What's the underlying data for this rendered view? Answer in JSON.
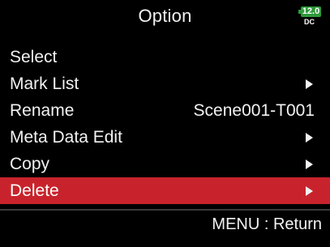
{
  "header": {
    "title": "Option",
    "battery_level": "12.0",
    "power_source": "DC"
  },
  "menu": {
    "items": [
      {
        "label": "Select",
        "value": "",
        "has_arrow": false
      },
      {
        "label": "Mark List",
        "value": "",
        "has_arrow": true
      },
      {
        "label": "Rename",
        "value": "Scene001-T001",
        "has_arrow": false
      },
      {
        "label": "Meta Data Edit",
        "value": "",
        "has_arrow": true
      },
      {
        "label": "Copy",
        "value": "",
        "has_arrow": true
      },
      {
        "label": "Delete",
        "value": "",
        "has_arrow": true,
        "selected": true
      }
    ]
  },
  "footer": {
    "hint": "MENU : Return"
  },
  "colors": {
    "background": "#000000",
    "selection": "#c8232c",
    "battery": "#2e9a3a",
    "text": "#f2f2f2"
  }
}
